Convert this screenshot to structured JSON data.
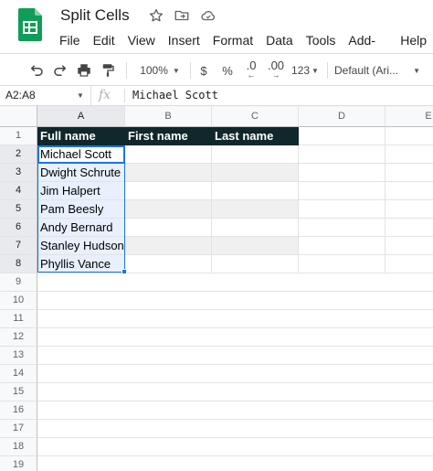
{
  "document": {
    "title": "Split Cells"
  },
  "menu": [
    "File",
    "Edit",
    "View",
    "Insert",
    "Format",
    "Data",
    "Tools",
    "Add-ons",
    "Help"
  ],
  "toolbar": {
    "zoom": "100%",
    "currency": "$",
    "percent": "%",
    "decrease_decimal": ".0",
    "increase_decimal": ".00",
    "more_formats": "123",
    "font": "Default (Ari..."
  },
  "formula_bar": {
    "name_box": "A2:A8",
    "fx": "fx",
    "content": "Michael Scott"
  },
  "sheet": {
    "columns": [
      "A",
      "B",
      "C",
      "D",
      "E"
    ],
    "rows": [
      "1",
      "2",
      "3",
      "4",
      "5",
      "6",
      "7",
      "8",
      "9",
      "10",
      "11",
      "12",
      "13",
      "14",
      "15",
      "16",
      "17",
      "18",
      "19"
    ],
    "header_row": [
      "Full name",
      "First name",
      "Last name"
    ],
    "cells_a": [
      "Michael Scott",
      "Dwight Schrute",
      "Jim Halpert",
      "Pam Beesly",
      "Andy Bernard",
      "Stanley Hudson",
      "Phyllis Vance"
    ]
  },
  "colors": {
    "header_fill": "#10272b",
    "header_text": "#ffffff",
    "band_fill": "#f0f0f0",
    "selection": "#1a73e8",
    "logo": "#0f9d58"
  }
}
